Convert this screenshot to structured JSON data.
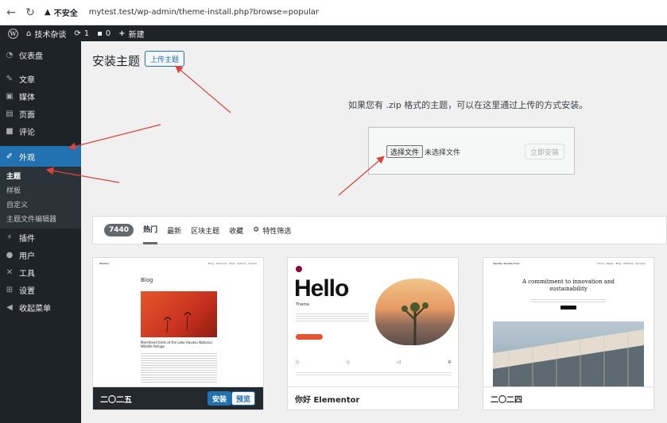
{
  "browser": {
    "insecure_label": "不安全",
    "url": "mytest.test/wp-admin/theme-install.php?browse=popular"
  },
  "adminbar": {
    "site_name": "技术杂谈",
    "updates_count": "1",
    "comments_count": "0",
    "new_label": "新建"
  },
  "sidebar": {
    "items": [
      {
        "label": "仪表盘",
        "icon": "dashboard-icon"
      },
      {
        "label": "文章",
        "icon": "pin-icon"
      },
      {
        "label": "媒体",
        "icon": "media-icon"
      },
      {
        "label": "页面",
        "icon": "page-icon"
      },
      {
        "label": "评论",
        "icon": "comment-icon"
      },
      {
        "label": "外观",
        "icon": "brush-icon"
      },
      {
        "label": "插件",
        "icon": "plugin-icon"
      },
      {
        "label": "用户",
        "icon": "user-icon"
      },
      {
        "label": "工具",
        "icon": "wrench-icon"
      },
      {
        "label": "设置",
        "icon": "settings-icon"
      },
      {
        "label": "收起菜单",
        "icon": "collapse-icon"
      }
    ],
    "submenu": [
      "主题",
      "样板",
      "自定义",
      "主题文件编辑器"
    ]
  },
  "main": {
    "title": "安装主题",
    "upload_button": "上传主题",
    "upload_help": "如果您有 .zip 格式的主题，可以在这里通过上传的方式安装。",
    "choose_file": "选择文件",
    "no_file": "未选择文件",
    "install_now": "立即安装"
  },
  "filter": {
    "count": "7440",
    "tabs": [
      "热门",
      "最新",
      "区块主题",
      "收藏"
    ],
    "feature_filter": "特性筛选"
  },
  "themes": [
    {
      "name": "二〇二五",
      "install": "安装",
      "preview": "预览",
      "shot_title": "Blog",
      "shot_site": "Stories",
      "shot_caption": "Marshland birds at the Lake Havasu National Wildlife Refuge"
    },
    {
      "name": "你好 Elementor",
      "shot_hello": "Hello",
      "shot_theme": "Theme"
    },
    {
      "name": "二〇二四",
      "shot_headline": "A commitment to innovation and sustainability",
      "shot_site": "Twenty Twenty Four"
    }
  ],
  "colors": {
    "accent": "#2271b1",
    "admin_dark": "#1d2327",
    "annotation_arrow": "#e0413a"
  }
}
